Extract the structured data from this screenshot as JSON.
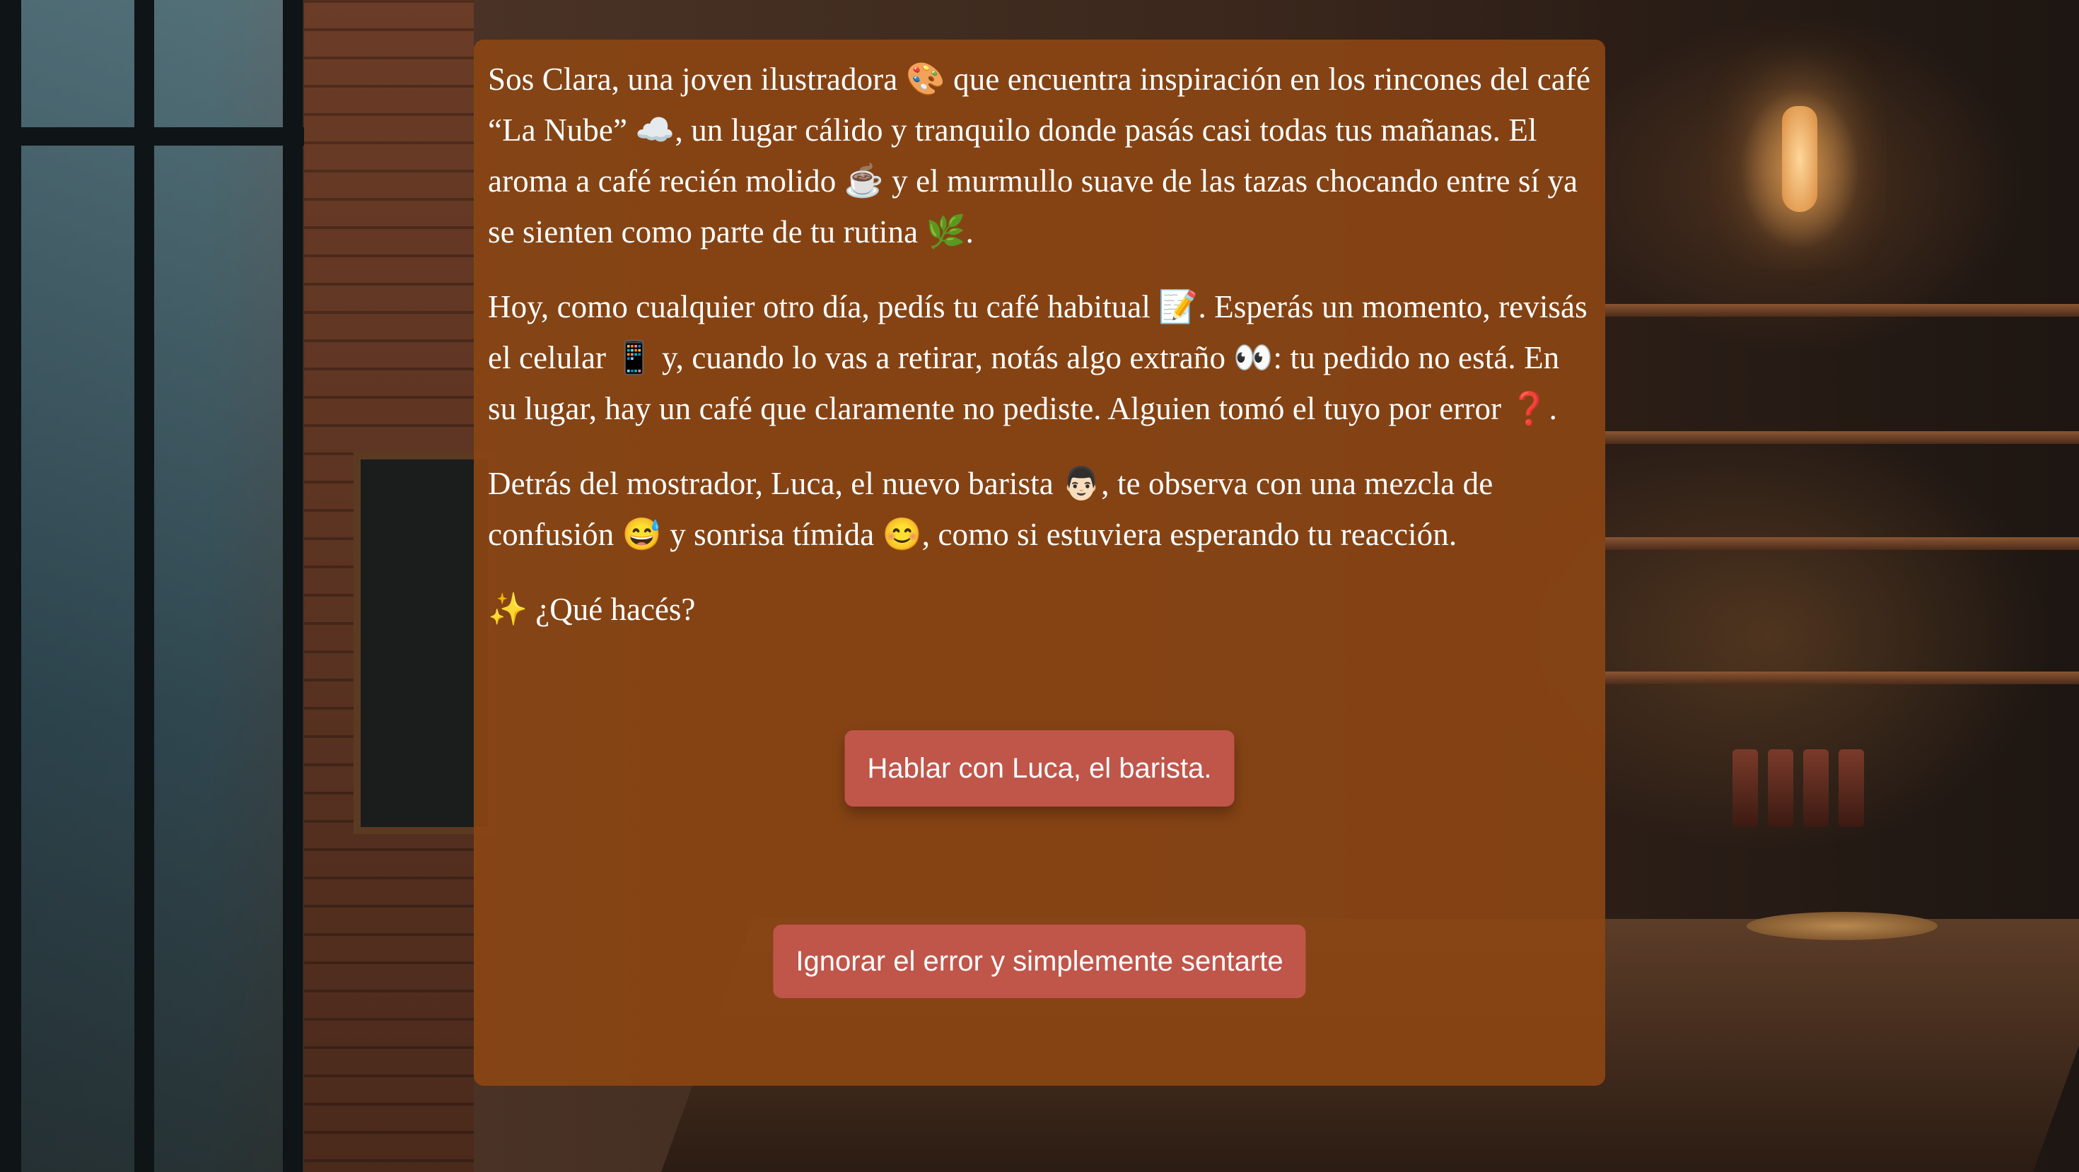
{
  "story": {
    "paragraphs": [
      "Sos Clara, una joven ilustradora 🎨 que encuentra inspiración en los rincones del café “La Nube” ☁️, un lugar cálido y tranquilo donde pasás casi todas tus mañanas. El aroma a café recién molido ☕ y el murmullo suave de las tazas chocando entre sí ya se sienten como parte de tu rutina 🌿.",
      "Hoy, como cualquier otro día, pedís tu café habitual 📝. Esperás un momento, revisás el celular 📱 y, cuando lo vas a retirar, notás algo extraño 👀: tu pedido no está. En su lugar, hay un café que claramente no pediste. Alguien tomó el tuyo por error ❓.",
      "Detrás del mostrador, Luca, el nuevo barista 👨🏻, te observa con una mezcla de confusión 😅 y sonrisa tímida 😊, como si estuviera esperando tu reacción."
    ],
    "prompt": "✨ ¿Qué hacés?"
  },
  "choices": [
    {
      "label": "Hablar con Luca, el barista."
    },
    {
      "label": "Ignorar el error y simplemente sentarte"
    }
  ],
  "colors": {
    "panel": "#8B4513",
    "button": "#C0554A",
    "text": "#FFFFFF"
  }
}
